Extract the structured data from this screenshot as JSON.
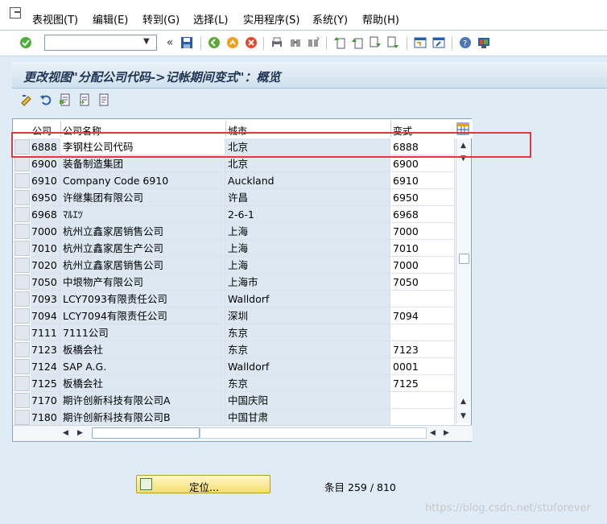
{
  "menu": [
    "表视图(T)",
    "编辑(E)",
    "转到(G)",
    "选择(L)",
    "实用程序(S)",
    "系统(Y)",
    "帮助(H)"
  ],
  "title": "更改视图\"分配公司代码->记帐期间变式\"：概览",
  "columns": [
    "公司",
    "公司名称",
    "城市",
    "变式"
  ],
  "rows": [
    {
      "code": "6888",
      "name": "李钢柱公司代码",
      "city": "北京",
      "variant": "6888"
    },
    {
      "code": "6900",
      "name": "装备制造集团",
      "city": "北京",
      "variant": "6900"
    },
    {
      "code": "6910",
      "name": "Company Code 6910",
      "city": "Auckland",
      "variant": "6910"
    },
    {
      "code": "6950",
      "name": "许继集团有限公司",
      "city": "许昌",
      "variant": "6950"
    },
    {
      "code": "6968",
      "name": "ﾏﾙｴﾂ",
      "city": "2-6-1",
      "variant": "6968"
    },
    {
      "code": "7000",
      "name": "杭州立鑫家居销售公司",
      "city": "上海",
      "variant": "7000"
    },
    {
      "code": "7010",
      "name": "杭州立鑫家居生产公司",
      "city": "上海",
      "variant": "7010"
    },
    {
      "code": "7020",
      "name": "杭州立鑫家居销售公司",
      "city": "上海",
      "variant": "7000"
    },
    {
      "code": "7050",
      "name": "中垠物产有限公司",
      "city": "上海市",
      "variant": "7050"
    },
    {
      "code": "7093",
      "name": "LCY7093有限责任公司",
      "city": "Walldorf",
      "variant": ""
    },
    {
      "code": "7094",
      "name": "LCY7094有限责任公司",
      "city": "深圳",
      "variant": "7094"
    },
    {
      "code": "7111",
      "name": "7111公司",
      "city": "东京",
      "variant": ""
    },
    {
      "code": "7123",
      "name": "板橋会社",
      "city": "东京",
      "variant": "7123"
    },
    {
      "code": "7124",
      "name": "SAP A.G.",
      "city": "Walldorf",
      "variant": "0001"
    },
    {
      "code": "7125",
      "name": "板橋会社",
      "city": "东京",
      "variant": "7125"
    },
    {
      "code": "7170",
      "name": "期许创新科技有限公司A",
      "city": "中国庆阳",
      "variant": ""
    },
    {
      "code": "7180",
      "name": "期许创新科技有限公司B",
      "city": "中国甘肃",
      "variant": ""
    }
  ],
  "position_button": "定位...",
  "entry_label": "条目",
  "entry_value": "259 / 810",
  "watermark": "https://blog.csdn.net/stuforever",
  "icons": {
    "enter": "check-icon",
    "save": "save-icon",
    "back": "back-icon",
    "exit": "exit-icon",
    "cancel": "cancel-icon",
    "print": "print-icon",
    "find": "find-icon",
    "find_next": "find-next-icon",
    "first_page": "first-page-icon",
    "prev_page": "previous-page-icon",
    "next_page": "next-page-icon",
    "last_page": "last-page-icon",
    "new_session": "new-session-icon",
    "shortcut": "shortcut-icon",
    "help": "help-icon",
    "layout": "layout-icon"
  },
  "colors": {
    "highlight_box": "#e3383f",
    "title_text": "#1f3553",
    "background": "#dfebf5"
  }
}
